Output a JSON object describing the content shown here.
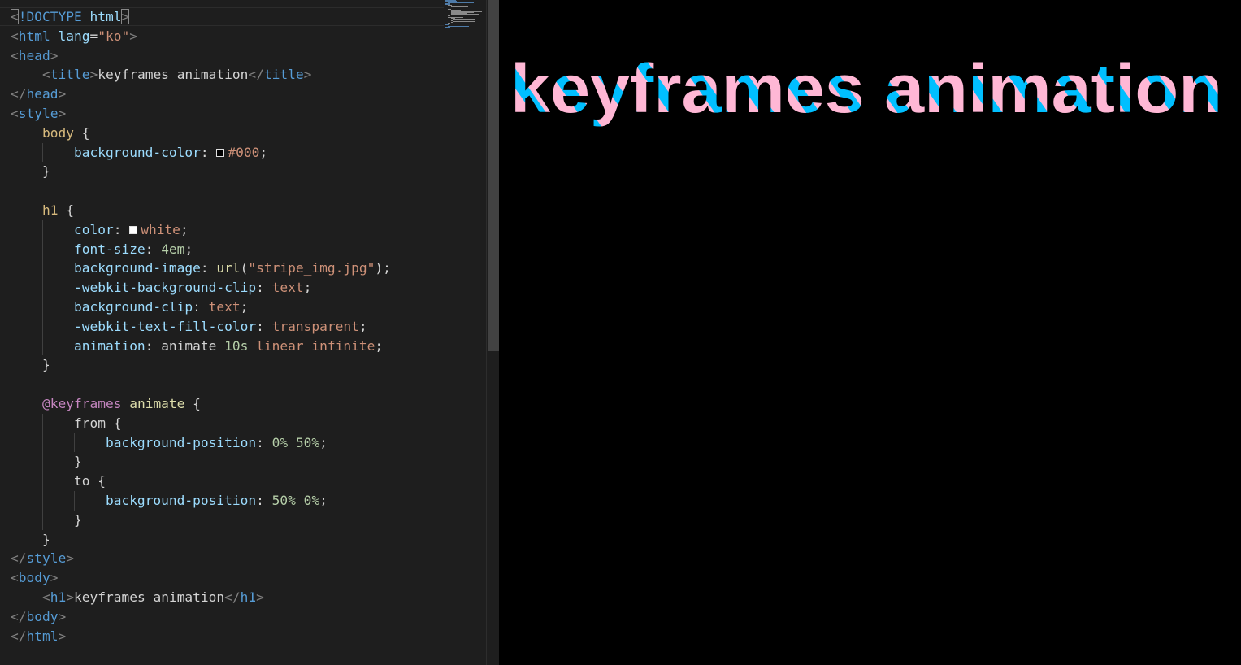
{
  "editor": {
    "code_lines": [
      "<!DOCTYPE html>",
      "<html lang=\"ko\">",
      "<head>",
      "    <title>keyframes animation</title>",
      "</head>",
      "<style>",
      "    body {",
      "        background-color: #000;",
      "    }",
      "",
      "    h1 {",
      "        color: white;",
      "        font-size: 4em;",
      "        background-image: url(\"stripe_img.jpg\");",
      "        -webkit-background-clip: text;",
      "        background-clip: text;",
      "        -webkit-text-fill-color: transparent;",
      "        animation: animate 10s linear infinite;",
      "    }",
      "",
      "    @keyframes animate {",
      "        from {",
      "            background-position: 0% 50%;",
      "        }",
      "        to {",
      "            background-position: 50% 0%;",
      "        }",
      "    }",
      "</style>",
      "<body>",
      "    <h1>keyframes animation</h1>",
      "</body>",
      "</html>"
    ],
    "swatch_colors": {
      "background-color": "#000000",
      "color": "#ffffff"
    },
    "theme": {
      "background": "#1e1e1e",
      "tag": "#569cd6",
      "attribute": "#9cdcfe",
      "string": "#ce9178",
      "selector": "#d7ba7d",
      "number": "#b5cea8",
      "function": "#dcdcaa",
      "at_rule": "#c586c0"
    }
  },
  "preview": {
    "heading": "keyframes animation",
    "background": "#000000",
    "stripe_colors": [
      "#ffb7d5",
      "#00bfff"
    ]
  }
}
